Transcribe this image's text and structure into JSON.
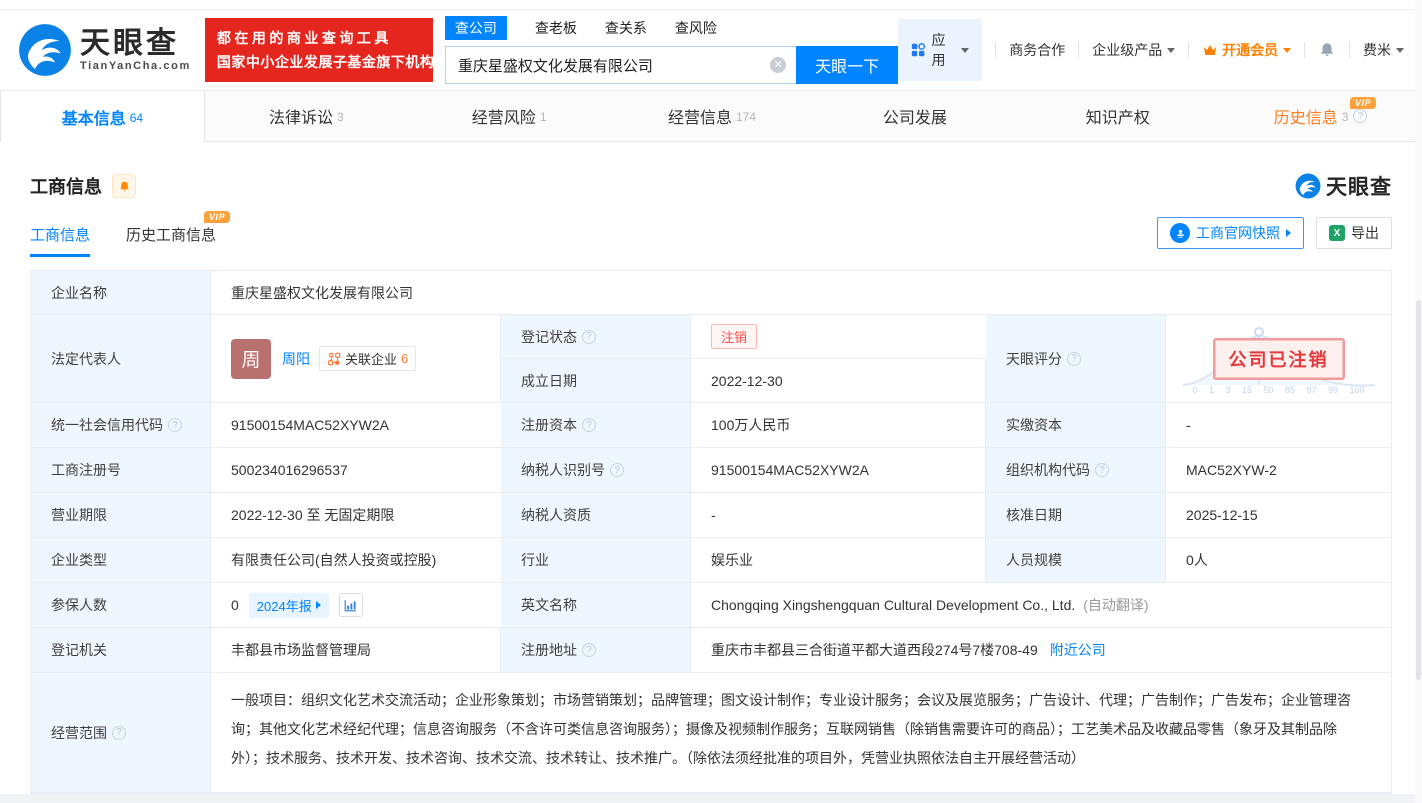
{
  "brand": {
    "name": "天眼查",
    "domain": "TianYanCha.com",
    "slogan_line1": "都在用的商业查询工具",
    "slogan_line2": "国家中小企业发展子基金旗下机构",
    "primary_color": "#0084ff",
    "banner_red": "#e5261f"
  },
  "search": {
    "tabs": [
      "查公司",
      "查老板",
      "查关系",
      "查风险"
    ],
    "value": "重庆星盛权文化发展有限公司",
    "button": "天眼一下"
  },
  "nav": {
    "apps": "应用",
    "cooperation": "商务合作",
    "enterprise": "企业级产品",
    "vip": "开通会员",
    "username": "费米"
  },
  "vip_badge": "VIP",
  "tabs": [
    {
      "label": "基本信息",
      "count": "64"
    },
    {
      "label": "法律诉讼",
      "count": "3"
    },
    {
      "label": "经营风险",
      "count": "1"
    },
    {
      "label": "经营信息",
      "count": "174"
    },
    {
      "label": "公司发展",
      "count": ""
    },
    {
      "label": "知识产权",
      "count": ""
    },
    {
      "label": "历史信息",
      "count": "3"
    }
  ],
  "section": {
    "title": "工商信息",
    "subtab1": "工商信息",
    "subtab2": "历史工商信息",
    "snapshot_button": "工商官网快照",
    "export_button": "导出",
    "watermark": "天眼查"
  },
  "fields": {
    "company_name_label": "企业名称",
    "company_name": "重庆星盛权文化发展有限公司",
    "legal_rep_label": "法定代表人",
    "legal_rep_avatar": "周",
    "legal_rep_name": "周阳",
    "related_company_label": "关联企业",
    "related_company_count": "6",
    "reg_status_label": "登记状态",
    "reg_status": "注销",
    "establish_label": "成立日期",
    "establish_date": "2022-12-30",
    "score_label": "天眼评分",
    "credit_code_label": "统一社会信用代码",
    "credit_code": "91500154MAC52XYW2A",
    "reg_capital_label": "注册资本",
    "reg_capital": "100万人民币",
    "paid_capital_label": "实缴资本",
    "paid_capital": "-",
    "reg_number_label": "工商注册号",
    "reg_number": "500234016296537",
    "taxpayer_id_label": "纳税人识别号",
    "taxpayer_id": "91500154MAC52XYW2A",
    "org_code_label": "组织机构代码",
    "org_code": "MAC52XYW-2",
    "business_term_label": "营业期限",
    "business_term": "2022-12-30 至 无固定期限",
    "taxpayer_quality_label": "纳税人资质",
    "taxpayer_quality": "-",
    "approval_date_label": "核准日期",
    "approval_date": "2025-12-15",
    "company_type_label": "企业类型",
    "company_type": "有限责任公司(自然人投资或控股)",
    "industry_label": "行业",
    "industry": "娱乐业",
    "staff_size_label": "人员规模",
    "staff_size": "0人",
    "insured_label": "参保人数",
    "insured_count": "0",
    "annual_report": "2024年报",
    "english_name_label": "英文名称",
    "english_name": "Chongqing Xingshengquan Cultural Development Co., Ltd.",
    "english_name_note": "(自动翻译)",
    "reg_authority_label": "登记机关",
    "reg_authority": "丰都县市场监督管理局",
    "address_label": "注册地址",
    "address": "重庆市丰都县三合街道平都大道西段274号7楼708-49",
    "nearby_link": "附近公司",
    "scope_label": "经营范围",
    "scope": "一般项目：组织文化艺术交流活动；企业形象策划；市场营销策划；品牌管理；图文设计制作；专业设计服务；会议及展览服务；广告设计、代理；广告制作；广告发布；企业管理咨询；其他文化艺术经纪代理；信息咨询服务（不含许可类信息咨询服务）；摄像及视频制作服务；互联网销售（除销售需要许可的商品）；工艺美术品及收藏品零售（象牙及其制品除外）；技术服务、技术开发、技术咨询、技术交流、技术转让、技术推广。（除依法须经批准的项目外，凭营业执照依法自主开展经营活动）"
  },
  "stamp": {
    "text": "公司已注销",
    "axis": "0 1 3 15 50 85 97 99 100"
  }
}
